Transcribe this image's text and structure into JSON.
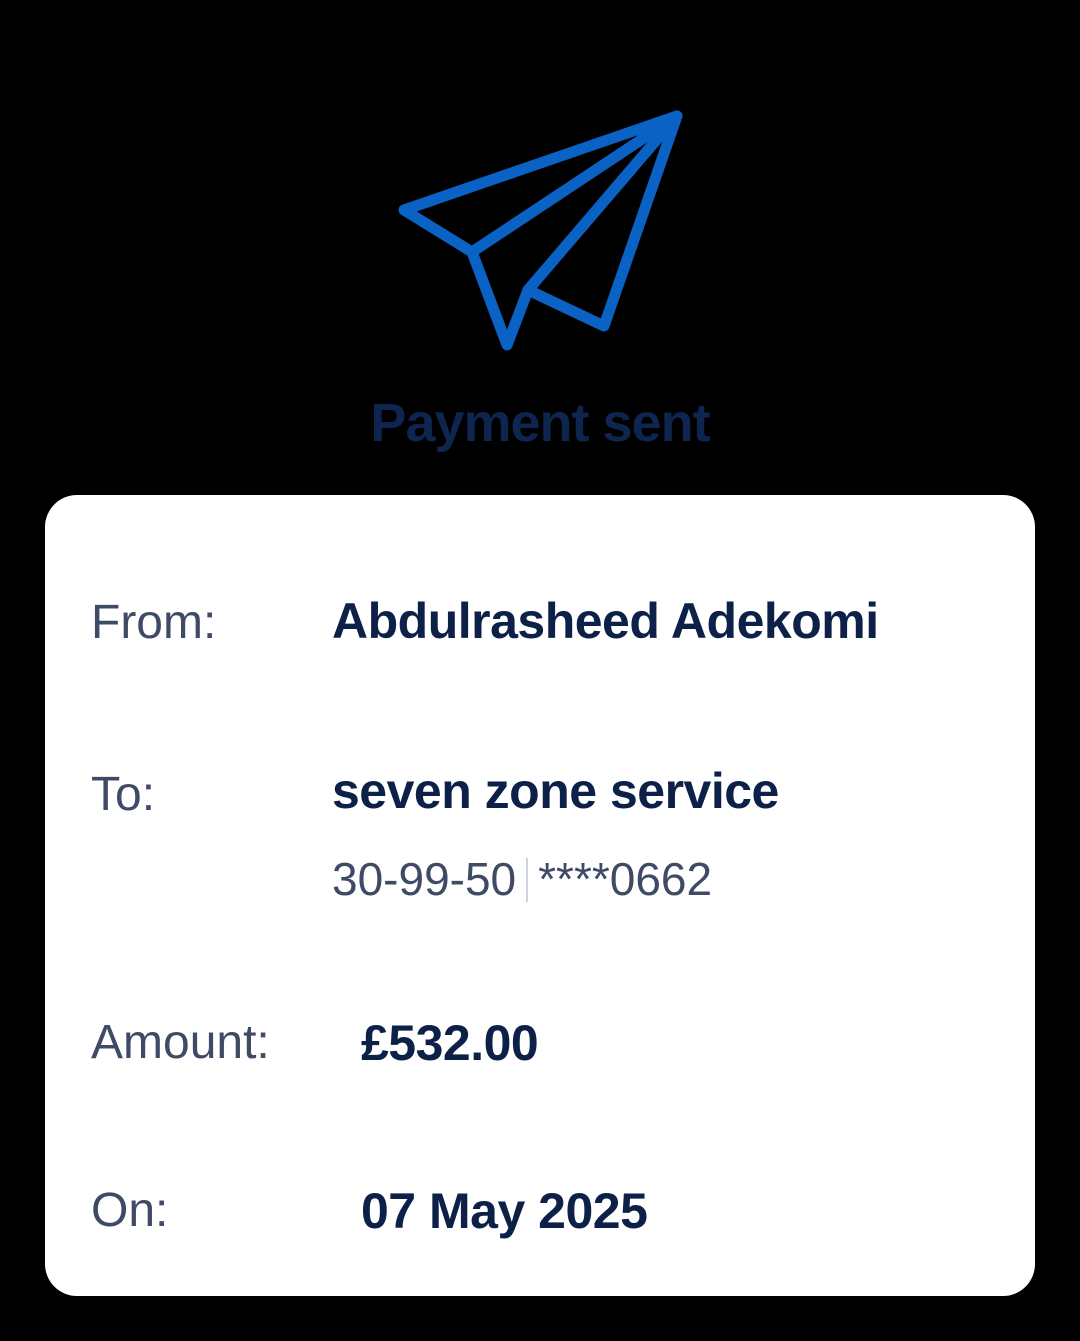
{
  "header": {
    "icon": "paper-plane-icon",
    "title": "Payment sent"
  },
  "colors": {
    "background": "#000000",
    "icon": "#0a63c4",
    "title": "#0e2550",
    "card": "#ffffff",
    "label": "#3f4b64",
    "value": "#0d2148",
    "subvalue": "#3f4b64"
  },
  "details": {
    "from": {
      "label": "From:",
      "value": "Abdulrasheed Adekomi"
    },
    "to": {
      "label": "To:",
      "value": "seven zone service",
      "sort_code": "30-99-50",
      "account": "****0662"
    },
    "amount": {
      "label": "Amount:",
      "value": "£532.00"
    },
    "on": {
      "label": "On:",
      "value": "07 May 2025"
    }
  }
}
